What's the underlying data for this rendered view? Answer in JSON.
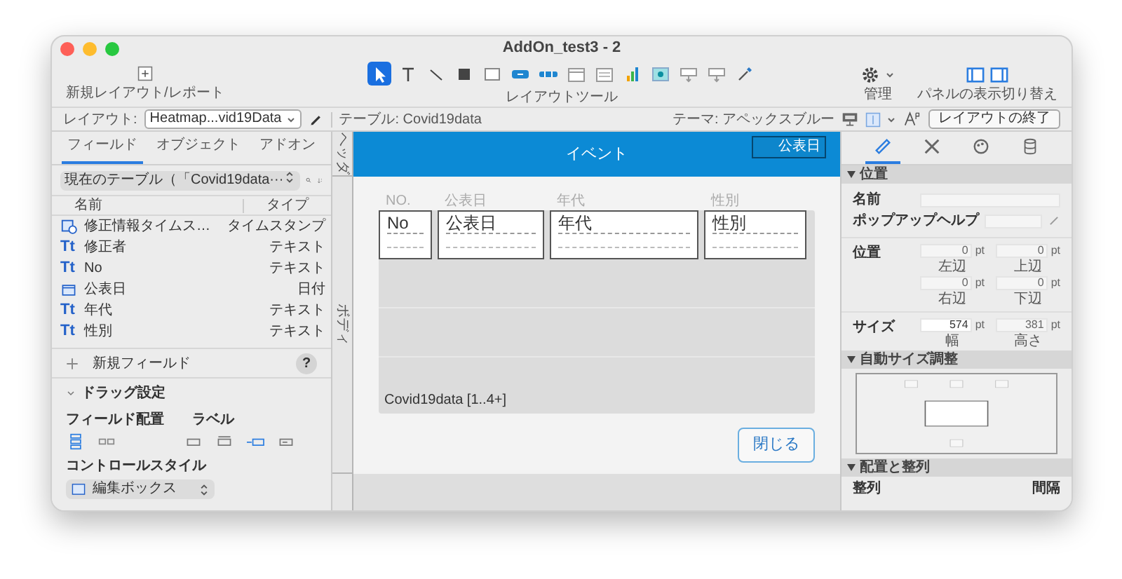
{
  "window": {
    "title": "AddOn_test3 - 2"
  },
  "toolbar": {
    "new_layout": "新規レイアウト/レポート",
    "tools_label": "レイアウトツール",
    "tools": [
      {
        "kind": "pointer",
        "selected": true
      },
      {
        "kind": "text",
        "selected": false
      },
      {
        "kind": "line",
        "selected": false
      },
      {
        "kind": "rectangle",
        "selected": false
      },
      {
        "kind": "field",
        "selected": false
      },
      {
        "kind": "button",
        "selected": false
      },
      {
        "kind": "button-bar",
        "selected": false
      },
      {
        "kind": "tab-control",
        "selected": false
      },
      {
        "kind": "slide-control",
        "selected": false
      },
      {
        "kind": "chart",
        "selected": false
      },
      {
        "kind": "web-viewer",
        "selected": false
      },
      {
        "kind": "popover",
        "selected": false
      },
      {
        "kind": "popover",
        "selected": false
      },
      {
        "kind": "eyedropper",
        "selected": false
      }
    ],
    "manage": "管理",
    "panels": "パネルの表示切り替え"
  },
  "layout_bar": {
    "layout_label": "レイアウト:",
    "layout_value": "Heatmap...vid19Data",
    "table": "テーブル: Covid19data",
    "theme": "テーマ: アペックスブルー",
    "exit_button": "レイアウトの終了"
  },
  "left_panel": {
    "tabs": [
      {
        "label": "フィールド",
        "selected": true
      },
      {
        "label": "オブジェクト",
        "selected": false
      },
      {
        "label": "アドオン",
        "selected": false
      }
    ],
    "table_selector": "現在のテーブル（「Covid19data···",
    "columns": [
      "名前",
      "タイプ"
    ],
    "fields": [
      {
        "kind": "timestamp",
        "name": "修正情報タイムス…",
        "type": "タイムスタンプ"
      },
      {
        "kind": "text",
        "icon": "Tt",
        "name": "修正者",
        "type": "テキスト"
      },
      {
        "kind": "text",
        "icon": "Tt",
        "name": "No",
        "type": "テキスト"
      },
      {
        "kind": "date",
        "name": "公表日",
        "type": "日付"
      },
      {
        "kind": "text",
        "icon": "Tt",
        "name": "年代",
        "type": "テキスト"
      },
      {
        "kind": "text",
        "icon": "Tt",
        "name": "性別",
        "type": "テキスト"
      }
    ],
    "new_field": "新規フィールド",
    "help": "?",
    "drag_settings": {
      "title": "ドラッグ設定",
      "expanded": true,
      "placement_label": "フィールド配置",
      "placement_options": [
        {
          "kind": "vertical",
          "selected": true
        },
        {
          "kind": "horizontal",
          "selected": false
        }
      ],
      "label_label": "ラベル",
      "label_options": [
        {
          "kind": "none",
          "selected": false
        },
        {
          "kind": "top",
          "selected": false
        },
        {
          "kind": "left",
          "selected": true
        },
        {
          "kind": "inside",
          "selected": false
        }
      ],
      "control_style_label": "コントロールスタイル",
      "control_style": "編集ボックス"
    }
  },
  "layout": {
    "header_part": "ヘッダ",
    "body_part": "ボディ",
    "header_title": "イベント",
    "header_field": "公表日",
    "column_labels": [
      "NO.",
      "公表日",
      "年代",
      "性別"
    ],
    "portal_fields": [
      "No",
      "公表日",
      "年代",
      "性別"
    ],
    "portal_label": "Covid19data [1..4+]",
    "close_button": "閉じる"
  },
  "inspector": {
    "tabs": [
      {
        "kind": "position",
        "selected": true
      },
      {
        "kind": "styles",
        "selected": false
      },
      {
        "kind": "appearance",
        "selected": false
      },
      {
        "kind": "data",
        "selected": false
      }
    ],
    "position_section": {
      "title": "位置",
      "expanded": true,
      "name_label": "名前",
      "tooltip_label": "ポップアップヘルプ",
      "position_label": "位置",
      "position_fields": [
        {
          "value": "0",
          "unit": "pt",
          "caption": "左辺"
        },
        {
          "value": "0",
          "unit": "pt",
          "caption": "上辺"
        },
        {
          "value": "0",
          "unit": "pt",
          "caption": "右辺"
        },
        {
          "value": "0",
          "unit": "pt",
          "caption": "下辺"
        }
      ],
      "size_label": "サイズ",
      "size_fields": [
        {
          "value": "574",
          "unit": "pt",
          "caption": "幅"
        },
        {
          "value": "381",
          "unit": "pt",
          "caption": "高さ"
        }
      ]
    },
    "autosize_section": {
      "title": "自動サイズ調整",
      "expanded": true
    },
    "arrange_section": {
      "title": "配置と整列",
      "expanded": true,
      "align_label": "整列",
      "spacing_label": "間隔"
    }
  }
}
